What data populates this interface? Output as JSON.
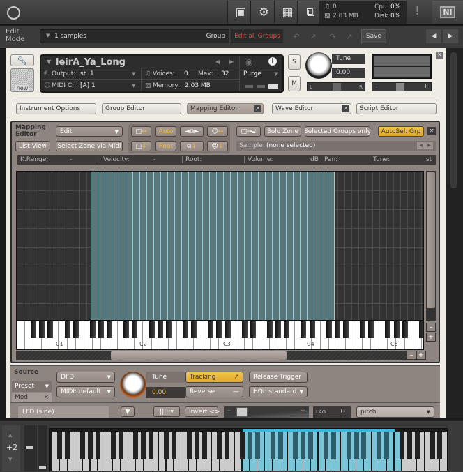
{
  "topbar": {
    "logo_icon": "kontakt-logo-icon",
    "buttons": [
      {
        "name": "save-icon",
        "glyph": "💾"
      },
      {
        "name": "gear-icon",
        "glyph": "⚙"
      },
      {
        "name": "layout-icon",
        "glyph": "▦"
      },
      {
        "name": "minimize-view-icon",
        "glyph": "⧉"
      }
    ],
    "voices_count": "0",
    "memory": "2.03 MB",
    "cpu_label": "Cpu",
    "cpu_value": "0%",
    "disk_label": "Disk",
    "disk_value": "0%",
    "warning_glyph": "!",
    "ni_logo": "NI"
  },
  "editrow": {
    "mode_line1": "Edit",
    "mode_line2": "Mode",
    "samples_label": "1 samples",
    "group_label": "Group",
    "edit_all_groups": "Edit all Groups",
    "save_label": "Save",
    "undo_glyph": "↶",
    "redo_glyph": "↷",
    "prev_glyph": "◀",
    "next_glyph": "▶"
  },
  "instrument": {
    "name": "leirA_Ya_Long",
    "output_label": "Output:",
    "output_value": "st. 1",
    "midi_label": "MIDI Ch:",
    "midi_value": "[A]  1",
    "voices_label": "Voices:",
    "voices_value": "0",
    "max_label": "Max:",
    "max_value": "32",
    "memory_label": "Memory:",
    "memory_value": "2.03 MB",
    "purge_label": "Purge",
    "solo_label": "S",
    "mute_label": "M",
    "tune_label": "Tune",
    "tune_value": "0.00",
    "pan_left": "L",
    "pan_right": "R",
    "vol_minus": "–",
    "vol_plus": "+",
    "new_label": "new",
    "close_glyph": "×"
  },
  "tabs": [
    {
      "label": "Instrument Options",
      "active": false
    },
    {
      "label": "Group Editor",
      "active": false
    },
    {
      "label": "Mapping Editor",
      "active": true
    },
    {
      "label": "Wave Editor",
      "active": false
    },
    {
      "label": "Script Editor",
      "active": false
    }
  ],
  "mapping": {
    "title_line1": "Mapping",
    "title_line2": "Editor",
    "edit_select": "Edit",
    "list_view": "List View",
    "select_zone_midi": "Select Zone via Midi",
    "auto": "Auto",
    "root": "Root",
    "solo_zone": "Solo Zone",
    "selected_groups_only": "Selected Groups only",
    "autosel_grp": "AutoSel. Grp",
    "sample_label": "Sample:",
    "sample_value": "(none selected)",
    "info": {
      "krange_label": "K.Range:",
      "krange_value": "-",
      "velocity_label": "Velocity:",
      "velocity_value": "-",
      "root_label": "Root:",
      "volume_label": "Volume:",
      "volume_unit": "dB",
      "pan_label": "Pan:",
      "tune_label": "Tune:",
      "tune_unit": "st"
    },
    "octave_labels": [
      "C1",
      "C2",
      "C3",
      "C4",
      "C5"
    ],
    "zone_count": 35,
    "zone_color": "#5e7a7c",
    "zone_border": "#9fd6dc"
  },
  "source": {
    "title": "Source",
    "preset_label": "Preset",
    "mod_label": "Mod",
    "dfd": "DFD",
    "midi_default": "MIDI: default",
    "tune_label": "Tune",
    "tune_value": "0.00",
    "tracking": "Tracking",
    "reverse": "Reverse",
    "release_trigger": "Release Trigger",
    "hqi": "HQI: standard",
    "lfo_label": "LFO (sine)",
    "invert": "Invert <>",
    "lag_label": "LAG",
    "lag_value": "0",
    "pitch_target": "pitch",
    "mod_minus": "–",
    "mod_plus": "+"
  },
  "bottom_keyboard": {
    "octave_offset": "+2",
    "up_glyph": "▲",
    "down_glyph": "▼",
    "highlight_color": "#7cc4d8"
  }
}
